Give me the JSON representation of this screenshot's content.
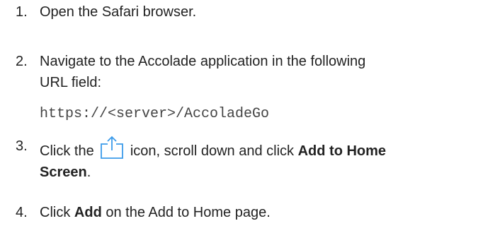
{
  "steps": [
    {
      "number": "1.",
      "text": "Open the Safari browser."
    },
    {
      "number": "2.",
      "line1": "Navigate to the Accolade application in the following",
      "line2": "URL field:",
      "url": "https://<server>/AccoladeGo"
    },
    {
      "number": "3.",
      "before_icon": "Click the",
      "icon": "share-icon",
      "after_icon": "icon, scroll down and click",
      "bold1": "Add to Home",
      "bold2": "Screen",
      "end": "."
    },
    {
      "number": "4.",
      "before": "Click",
      "bold": "Add",
      "after": "on the Add to Home page."
    }
  ],
  "colors": {
    "text": "#222222",
    "url": "#444444",
    "icon": "#3b9bea"
  }
}
